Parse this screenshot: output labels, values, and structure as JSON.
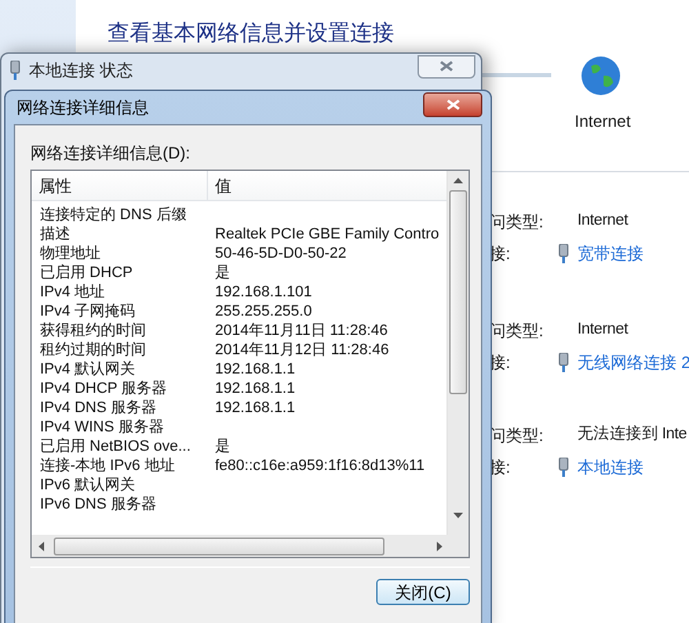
{
  "control_panel": {
    "heading": "查看基本网络信息并设置连接",
    "network_label": "Internet",
    "connections": [
      {
        "type_label": "问类型:",
        "type_value": "Internet",
        "link_label": "接:",
        "link": "宽带连接"
      },
      {
        "type_label": "问类型:",
        "type_value": "Internet",
        "link_label": "接:",
        "link": "无线网络连接 2"
      },
      {
        "type_label": "问类型:",
        "type_value": "无法连接到 Inte",
        "link_label": "接:",
        "link": "本地连接"
      }
    ]
  },
  "status_dialog": {
    "title": "本地连接 状态"
  },
  "details_dialog": {
    "title": "网络连接详细信息",
    "group_label": "网络连接详细信息(D):",
    "columns": [
      "属性",
      "值"
    ],
    "rows": [
      {
        "property": "连接特定的 DNS 后缀"
      },
      {
        "property": "描述",
        "value": "Realtek PCIe GBE Family Contro"
      },
      {
        "property": "物理地址",
        "value": "50-46-5D-D0-50-22"
      },
      {
        "property": "已启用 DHCP",
        "value": "是"
      },
      {
        "property": "IPv4 地址",
        "value": "192.168.1.101"
      },
      {
        "property": "IPv4 子网掩码",
        "value": "255.255.255.0"
      },
      {
        "property": "获得租约的时间",
        "value": "2014年11月11日 11:28:46"
      },
      {
        "property": "租约过期的时间",
        "value": "2014年11月12日 11:28:46"
      },
      {
        "property": "IPv4 默认网关",
        "value": "192.168.1.1"
      },
      {
        "property": "IPv4 DHCP 服务器",
        "value": "192.168.1.1"
      },
      {
        "property": "IPv4 DNS 服务器",
        "value": "192.168.1.1"
      },
      {
        "property": "IPv4 WINS 服务器"
      },
      {
        "property": "已启用 NetBIOS ove...",
        "value": "是"
      },
      {
        "property": "连接-本地 IPv6 地址",
        "value": "fe80::c16e:a959:1f16:8d13%11"
      },
      {
        "property": "IPv6 默认网关"
      },
      {
        "property": "IPv6 DNS 服务器"
      }
    ],
    "close_button": "关闭(C)"
  }
}
